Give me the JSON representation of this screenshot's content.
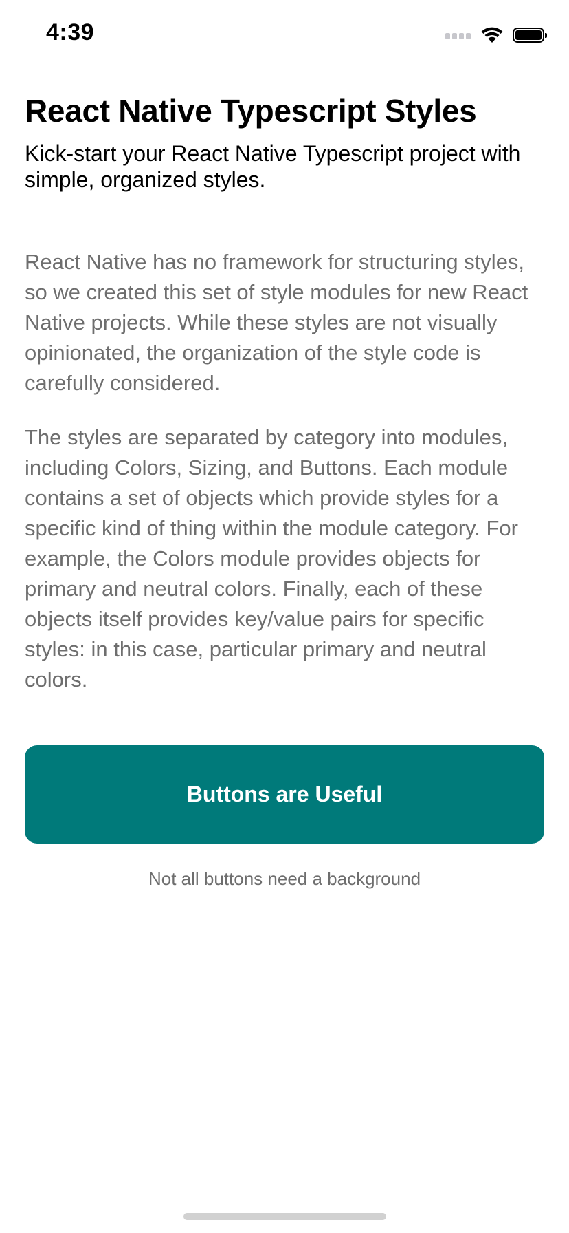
{
  "status_bar": {
    "time": "4:39",
    "icons": [
      "cellular-signal-icon",
      "wifi-icon",
      "battery-icon"
    ]
  },
  "header": {
    "title": "React Native Typescript Styles",
    "subtitle": "Kick-start your React Native Typescript project with simple, organized styles."
  },
  "body": {
    "paragraphs": [
      "React Native has no framework for structuring styles, so we created this set of style modules for new React Native projects. While these styles are not visually opinionated, the organization of the style code is carefully considered.",
      "The styles are separated by category into modules, including Colors, Sizing, and Buttons. Each module contains a set of objects which provide styles for a specific kind of thing within the module category. For example, the Colors module provides objects for primary and neutral colors. Finally, each of these objects itself provides key/value pairs for specific styles: in this case, particular primary and neutral colors."
    ]
  },
  "actions": {
    "primary_button_label": "Buttons are Useful",
    "text_button_label": "Not all buttons need a background"
  },
  "colors": {
    "primary": "#007a7a",
    "text_secondary": "#6e6e6e",
    "divider": "#d9d9d9"
  }
}
